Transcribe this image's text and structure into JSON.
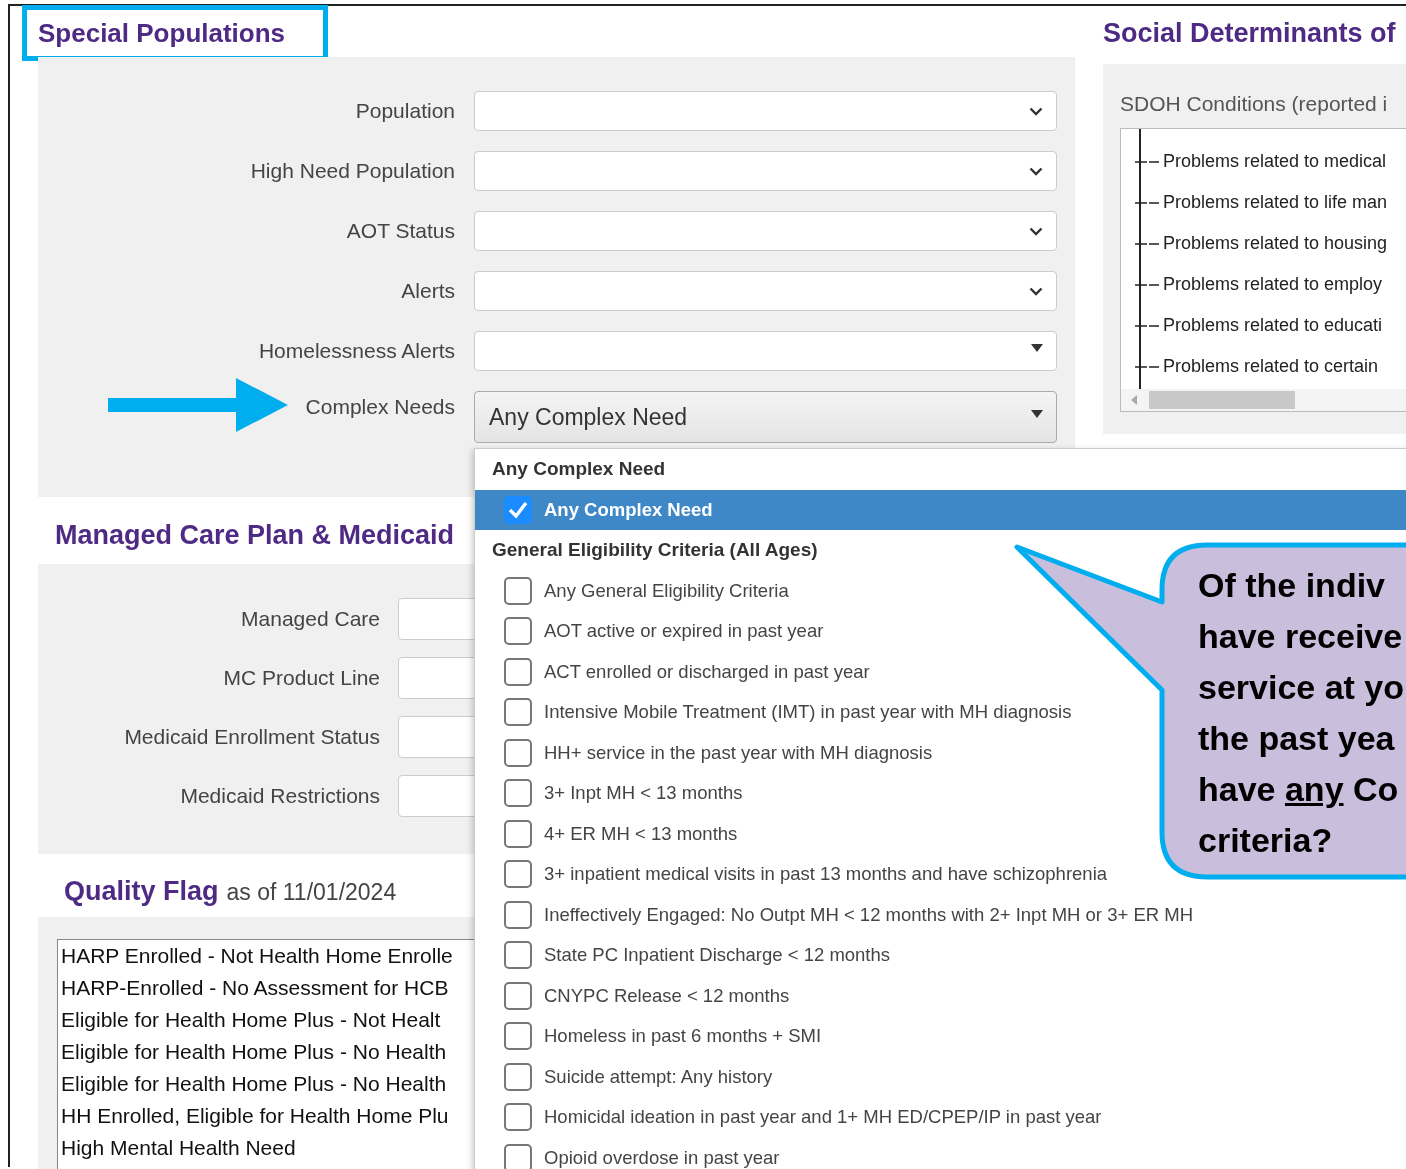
{
  "special_populations": {
    "title": "Special Populations",
    "fields": [
      {
        "label": "Population",
        "kind": "chevron",
        "expanded": false
      },
      {
        "label": "High Need Population",
        "kind": "chevron",
        "expanded": false
      },
      {
        "label": "AOT Status",
        "kind": "chevron",
        "expanded": false
      },
      {
        "label": "Alerts",
        "kind": "chevron",
        "expanded": false
      },
      {
        "label": "Homelessness Alerts",
        "kind": "triangle",
        "expanded": false
      },
      {
        "label": "Complex Needs",
        "kind": "triangle",
        "expanded": true,
        "value": "Any Complex Need"
      }
    ]
  },
  "complex_needs_menu": {
    "items": [
      {
        "kind": "group",
        "label": "Any Complex Need"
      },
      {
        "kind": "option",
        "label": "Any Complex Need",
        "checked": true,
        "selected": true
      },
      {
        "kind": "group",
        "label": "General Eligibility Criteria (All Ages)"
      },
      {
        "kind": "option",
        "label": "Any General Eligibility Criteria",
        "checked": false,
        "selected": false
      },
      {
        "kind": "option",
        "label": "AOT active or expired in past year",
        "checked": false,
        "selected": false
      },
      {
        "kind": "option",
        "label": "ACT enrolled or discharged in past year",
        "checked": false,
        "selected": false
      },
      {
        "kind": "option",
        "label": "Intensive Mobile Treatment (IMT) in past year with MH diagnosis",
        "checked": false,
        "selected": false
      },
      {
        "kind": "option",
        "label": "HH+ service in the past year with MH diagnosis",
        "checked": false,
        "selected": false
      },
      {
        "kind": "option",
        "label": "3+ Inpt MH < 13 months",
        "checked": false,
        "selected": false
      },
      {
        "kind": "option",
        "label": "4+ ER MH < 13 months",
        "checked": false,
        "selected": false
      },
      {
        "kind": "option",
        "label": "3+ inpatient medical visits in past 13 months and have schizophrenia",
        "checked": false,
        "selected": false
      },
      {
        "kind": "option",
        "label": "Ineffectively Engaged: No Outpt MH < 12 months with 2+ Inpt MH or 3+ ER MH",
        "checked": false,
        "selected": false
      },
      {
        "kind": "option",
        "label": "State PC Inpatient Discharge < 12 months",
        "checked": false,
        "selected": false
      },
      {
        "kind": "option",
        "label": "CNYPC Release < 12 months",
        "checked": false,
        "selected": false
      },
      {
        "kind": "option",
        "label": "Homeless in past 6 months + SMI",
        "checked": false,
        "selected": false
      },
      {
        "kind": "option",
        "label": "Suicide attempt: Any history",
        "checked": false,
        "selected": false
      },
      {
        "kind": "option",
        "label": "Homicidal ideation in past year and 1+ MH ED/CPEP/IP in past year",
        "checked": false,
        "selected": false
      },
      {
        "kind": "option",
        "label": "Opioid overdose in past year",
        "checked": false,
        "selected": false
      }
    ]
  },
  "managed_care": {
    "title": "Managed Care Plan & Medicaid",
    "fields": [
      {
        "label": "Managed Care"
      },
      {
        "label": "MC Product Line"
      },
      {
        "label": "Medicaid Enrollment Status"
      },
      {
        "label": "Medicaid Restrictions"
      }
    ]
  },
  "quality_flag": {
    "title": "Quality Flag",
    "subtitle": "as of 11/01/2024",
    "flags": [
      "HARP Enrolled - Not Health Home Enrolle",
      "HARP-Enrolled - No Assessment for HCB",
      "Eligible for Health Home Plus - Not Healt",
      "Eligible for Health Home Plus - No Health",
      "Eligible for Health Home Plus - No Health",
      "HH Enrolled, Eligible for Health Home Plu",
      "High Mental Health Need"
    ]
  },
  "sdoh": {
    "title": "Social Determinants of",
    "label": "SDOH Conditions (reported i",
    "conditions": [
      "Problems related to medical",
      "Problems related to life man",
      "Problems related to housing",
      "Problems related to employ",
      "Problems related to educati",
      "Problems related to certain"
    ]
  },
  "callout": {
    "lines": [
      [
        {
          "text": "Of the indiv",
          "underline": false
        }
      ],
      [
        {
          "text": "have receive",
          "underline": false
        }
      ],
      [
        {
          "text": "service at yo",
          "underline": false
        }
      ],
      [
        {
          "text": "the past yea",
          "underline": false
        }
      ],
      [
        {
          "text": "have ",
          "underline": false
        },
        {
          "text": "any",
          "underline": true
        },
        {
          "text": " Co",
          "underline": false
        }
      ],
      [
        {
          "text": "criteria?",
          "underline": false
        }
      ]
    ]
  }
}
